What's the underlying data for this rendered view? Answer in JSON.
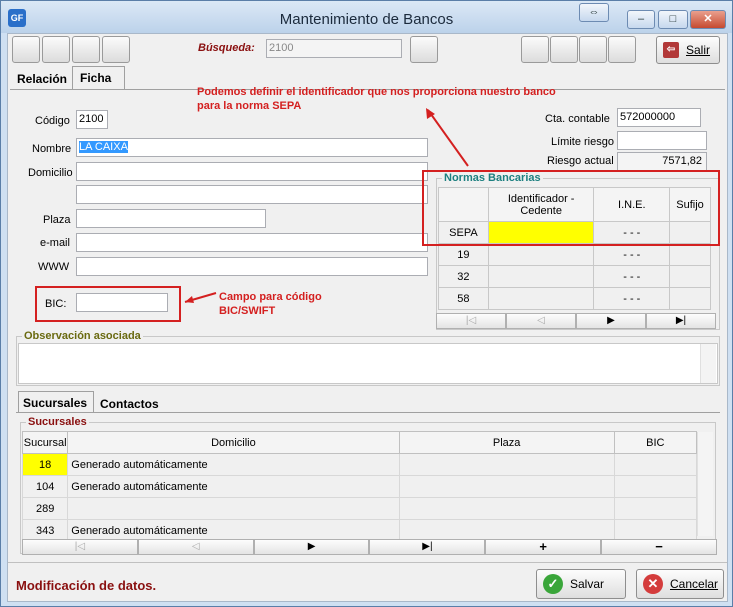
{
  "window": {
    "title": "Mantenimiento de Bancos",
    "app_icon": "GF",
    "drag_glyph": "⇔",
    "min_glyph": "–",
    "max_glyph": "□",
    "close_glyph": "✕"
  },
  "toolbar": {
    "search_label": "Búsqueda:",
    "search_value": "2100",
    "exit_label": "Salir",
    "exit_icon": "exit-door-icon"
  },
  "tabs": [
    "Relación",
    "Ficha"
  ],
  "form": {
    "codigo_label": "Código",
    "codigo": "2100",
    "nombre_label": "Nombre",
    "nombre": "LA CAIXA",
    "domicilio_label": "Domicilio",
    "domicilio1": "",
    "domicilio2": "",
    "plaza_label": "Plaza",
    "plaza": "",
    "email_label": "e-mail",
    "email": "",
    "www_label": "WWW",
    "www": "",
    "bic_label": "BIC:",
    "bic": "",
    "cta_label": "Cta. contable",
    "cta": "572000000",
    "limite_label": "Límite riesgo",
    "limite": "",
    "riesgo_label": "Riesgo actual",
    "riesgo": "7571,82"
  },
  "annotations": {
    "sepa": "Podemos definir el identificador que nos proporciona nuestro banco para la norma SEPA",
    "bic": "Campo para código BIC/SWIFT",
    "color": "#d42020"
  },
  "normas": {
    "title": "Normas Bancarias",
    "headers": [
      "",
      "Identificador - Cedente",
      "I.N.E.",
      "Sufijo"
    ],
    "rows": [
      {
        "norma": "SEPA",
        "id": "",
        "ine": "-  -  -",
        "sufijo": ""
      },
      {
        "norma": "19",
        "id": "",
        "ine": "-  -  -",
        "sufijo": ""
      },
      {
        "norma": "32",
        "id": "",
        "ine": "-  -  -",
        "sufijo": ""
      },
      {
        "norma": "58",
        "id": "",
        "ine": "-  -  -",
        "sufijo": ""
      }
    ],
    "highlight": "#ffff00"
  },
  "nav": {
    "first": "|◁",
    "prev": "◁",
    "next": "▶",
    "last": "▶|",
    "add": "+",
    "remove": "−"
  },
  "observacion": {
    "title": "Observación asociada",
    "text": ""
  },
  "lower_tabs": [
    "Sucursales",
    "Contactos"
  ],
  "sucursales": {
    "title": "Sucursales",
    "headers": [
      "Sucursal",
      "Domicilio",
      "Plaza",
      "BIC"
    ],
    "rows": [
      {
        "sucursal": "18",
        "domicilio": "Generado automáticamente",
        "plaza": "",
        "bic": ""
      },
      {
        "sucursal": "104",
        "domicilio": "Generado automáticamente",
        "plaza": "",
        "bic": ""
      },
      {
        "sucursal": "289",
        "domicilio": "",
        "plaza": "",
        "bic": ""
      },
      {
        "sucursal": "343",
        "domicilio": "Generado automáticamente",
        "plaza": "",
        "bic": ""
      }
    ]
  },
  "status": {
    "text": "Modificación de datos."
  },
  "buttons": {
    "save": "Salvar",
    "cancel": "Cancelar",
    "save_icon": "check-icon",
    "cancel_icon": "cancel-icon"
  }
}
